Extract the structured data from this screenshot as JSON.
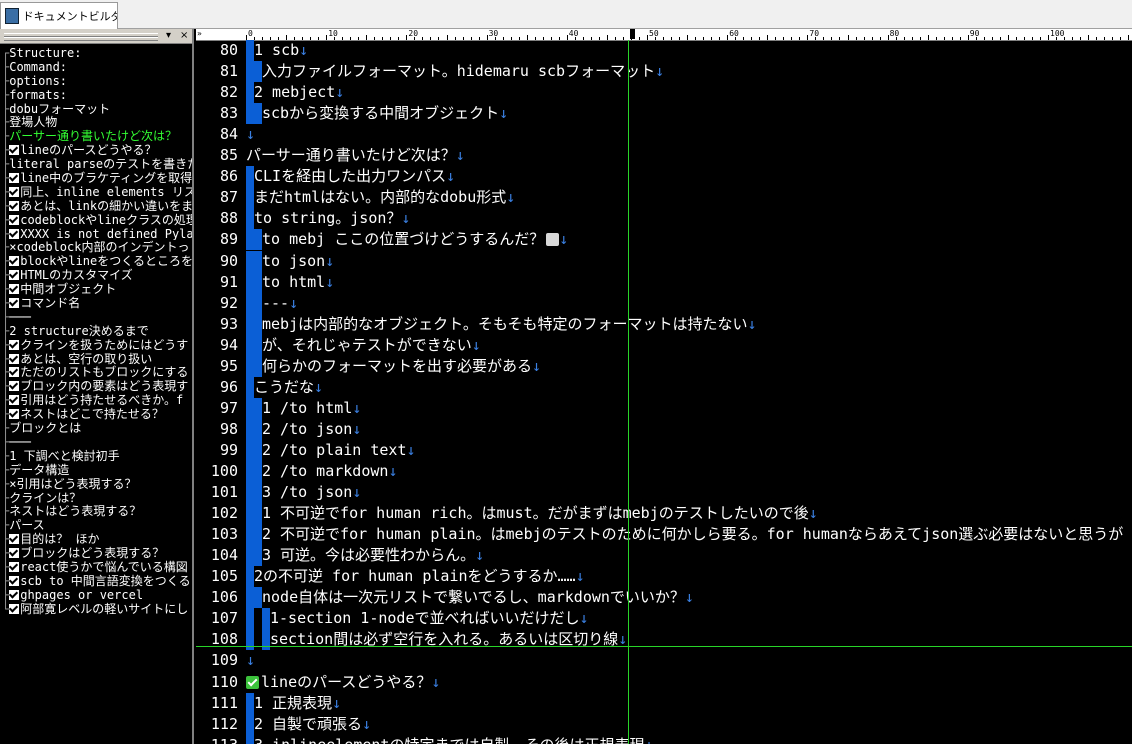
{
  "window": {
    "tab_title": "ドキュメントビルダー.",
    "panel_buttons": [
      "▾",
      "×"
    ],
    "scroll_indicator": "»"
  },
  "outline": [
    {
      "prefix": "┌",
      "text": "Structure:"
    },
    {
      "prefix": "├",
      "text": "Command:"
    },
    {
      "prefix": "├",
      "text": "options:"
    },
    {
      "prefix": "├",
      "text": "formats:"
    },
    {
      "prefix": "├",
      "text": "dobuフォーマット"
    },
    {
      "prefix": "├",
      "text": "登場人物"
    },
    {
      "prefix": "├",
      "text": "パーサー通り書いたけど次は？",
      "highlight": true
    },
    {
      "prefix": "├",
      "check": true,
      "text": "lineのパースどうやる？"
    },
    {
      "prefix": "├",
      "text": "literal parseのテストを書きた"
    },
    {
      "prefix": "├",
      "check": true,
      "text": "line中のブラケティングを取得"
    },
    {
      "prefix": "├",
      "check": true,
      "text": "同上、inline elements リス"
    },
    {
      "prefix": "├",
      "check": true,
      "text": "あとは、linkの細かい違いをま"
    },
    {
      "prefix": "├",
      "check": true,
      "text": "codeblockやlineクラスの処理"
    },
    {
      "prefix": "├",
      "check": true,
      "text": "XXXX is not defined Pylance"
    },
    {
      "prefix": "├",
      "text": "×codeblock内部のインデントっ"
    },
    {
      "prefix": "├",
      "check": true,
      "text": "blockやlineをつくるところを"
    },
    {
      "prefix": "├",
      "check": true,
      "text": "HTMLのカスタマイズ"
    },
    {
      "prefix": "├",
      "check": true,
      "text": "中間オブジェクト"
    },
    {
      "prefix": "├",
      "check": true,
      "text": "コマンド名"
    },
    {
      "prefix": "├",
      "text": "───"
    },
    {
      "prefix": "├",
      "text": "2 structure決めるまで"
    },
    {
      "prefix": "├",
      "check": true,
      "text": "クラインを扱うためにはどうす"
    },
    {
      "prefix": "├",
      "check": true,
      "text": "あとは、空行の取り扱い"
    },
    {
      "prefix": "├",
      "check": true,
      "text": "ただのリストもブロックにする"
    },
    {
      "prefix": "├",
      "check": true,
      "text": "ブロック内の要素はどう表現す"
    },
    {
      "prefix": "├",
      "check": true,
      "text": "引用はどう持たせるべきか。f"
    },
    {
      "prefix": "├",
      "check": true,
      "text": "ネストはどこで持たせる？"
    },
    {
      "prefix": "├",
      "text": "ブロックとは"
    },
    {
      "prefix": "├",
      "text": "───"
    },
    {
      "prefix": "├",
      "text": "1 下調べと検討初手"
    },
    {
      "prefix": "├",
      "text": "データ構造"
    },
    {
      "prefix": "├",
      "text": "×引用はどう表現する？"
    },
    {
      "prefix": "├",
      "text": "クラインは？"
    },
    {
      "prefix": "├",
      "text": "ネストはどう表現する？"
    },
    {
      "prefix": "├",
      "text": "パース"
    },
    {
      "prefix": "├",
      "check": true,
      "text": "目的は？ ほか"
    },
    {
      "prefix": "├",
      "check": true,
      "text": "ブロックはどう表現する？"
    },
    {
      "prefix": "├",
      "check": true,
      "text": "react使うかで悩んでいる構図"
    },
    {
      "prefix": "├",
      "check": true,
      "text": "scb to 中間言語変換をつくる"
    },
    {
      "prefix": "├",
      "check": true,
      "text": "ghpages or vercel"
    },
    {
      "prefix": "└",
      "check": true,
      "text": "阿部寛レベルの軽いサイトにし"
    }
  ],
  "ruler": {
    "labels": [
      "0",
      "10",
      "20",
      "30",
      "40",
      "50",
      "60",
      "70",
      "80",
      "90",
      "100"
    ]
  },
  "lines": [
    {
      "n": "80",
      "bars": [
        1
      ],
      "text": "1 scb",
      "ret": true
    },
    {
      "n": "81",
      "bars": [
        2
      ],
      "text": "入力ファイルフォーマット。hidemaru scbフォーマット",
      "ret": true
    },
    {
      "n": "82",
      "bars": [
        1
      ],
      "text": "2 mebject",
      "ret": true
    },
    {
      "n": "83",
      "bars": [
        2
      ],
      "text": "scbから変換する中間オブジェクト",
      "ret": true
    },
    {
      "n": "84",
      "bars": [],
      "text": "",
      "ret": true
    },
    {
      "n": "85",
      "bars": [],
      "text": "パーサー通り書いたけど次は？",
      "ret": true
    },
    {
      "n": "86",
      "bars": [
        1
      ],
      "text": "CLIを経由した出力ワンパス",
      "ret": true
    },
    {
      "n": "87",
      "bars": [
        1
      ],
      "text": "まだhtmlはない。内部的なdobu形式",
      "ret": true
    },
    {
      "n": "88",
      "bars": [
        1
      ],
      "text": "to string。json？",
      "ret": true
    },
    {
      "n": "89",
      "bars": [
        2
      ],
      "text": "to mebj ここの位置づけどうするんだ？",
      "icon": true,
      "ret": true
    },
    {
      "n": "90",
      "bars": [
        2
      ],
      "text": "to json",
      "ret": true
    },
    {
      "n": "91",
      "bars": [
        2
      ],
      "text": "to html",
      "ret": true
    },
    {
      "n": "92",
      "bars": [
        2
      ],
      "text": "---",
      "ret": true
    },
    {
      "n": "93",
      "bars": [
        2
      ],
      "text": "mebjは内部的なオブジェクト。そもそも特定のフォーマットは持たない",
      "ret": true
    },
    {
      "n": "94",
      "bars": [
        2
      ],
      "text": "が、それじゃテストができない",
      "ret": true
    },
    {
      "n": "95",
      "bars": [
        2
      ],
      "text": "何らかのフォーマットを出す必要がある",
      "ret": true
    },
    {
      "n": "96",
      "bars": [
        1
      ],
      "text": "こうだな",
      "ret": true
    },
    {
      "n": "97",
      "bars": [
        2
      ],
      "text": "1 /to html",
      "ret": true
    },
    {
      "n": "98",
      "bars": [
        2
      ],
      "text": "2 /to json",
      "ret": true
    },
    {
      "n": "99",
      "bars": [
        2
      ],
      "text": "2 /to plain text",
      "ret": true
    },
    {
      "n": "100",
      "bars": [
        2
      ],
      "text": "2 /to markdown",
      "ret": true
    },
    {
      "n": "101",
      "bars": [
        2
      ],
      "text": "3 /to json",
      "ret": true
    },
    {
      "n": "102",
      "bars": [
        2
      ],
      "text": "1 不可逆でfor human rich。はmust。だがまずはmebjのテストしたいので後",
      "ret": true
    },
    {
      "n": "103",
      "bars": [
        2
      ],
      "text": "2 不可逆でfor human plain。はmebjのテストのために何かしら要る。for humanならあえてjson選ぶ必要はないと思うが",
      "ret": false
    },
    {
      "n": "104",
      "bars": [
        2
      ],
      "text": "3 可逆。今は必要性わからん。",
      "ret": true
    },
    {
      "n": "105",
      "bars": [
        1
      ],
      "text": "2の不可逆 for human plainをどうするか……",
      "ret": true
    },
    {
      "n": "106",
      "bars": [
        2
      ],
      "text": "node自体は一次元リストで繋いでるし、markdownでいいか？",
      "ret": true
    },
    {
      "n": "107",
      "bars": [
        3
      ],
      "text": "1-section 1-nodeで並べればいいだけだし",
      "ret": true
    },
    {
      "n": "108",
      "bars": [
        3
      ],
      "text": "section間は必ず空行を入れる。あるいは区切り線",
      "ret": true
    },
    {
      "n": "109",
      "bars": [],
      "text": "",
      "ret": true
    },
    {
      "n": "110",
      "bars": [],
      "text": "lineのパースどうやる？",
      "check": true,
      "ret": true
    },
    {
      "n": "111",
      "bars": [
        1
      ],
      "text": "1 正規表現",
      "ret": true
    },
    {
      "n": "112",
      "bars": [
        1
      ],
      "text": "2 自製で頑張る",
      "ret": true
    },
    {
      "n": "113",
      "bars": [
        1
      ],
      "text": "3 inlineelementの特定までは自製、その後は正規表現",
      "ret": true
    }
  ],
  "return_mark": "↓",
  "colors": {
    "bar": "#0b5fd6",
    "guide": "#28d428",
    "highlight": "#33ff33"
  }
}
